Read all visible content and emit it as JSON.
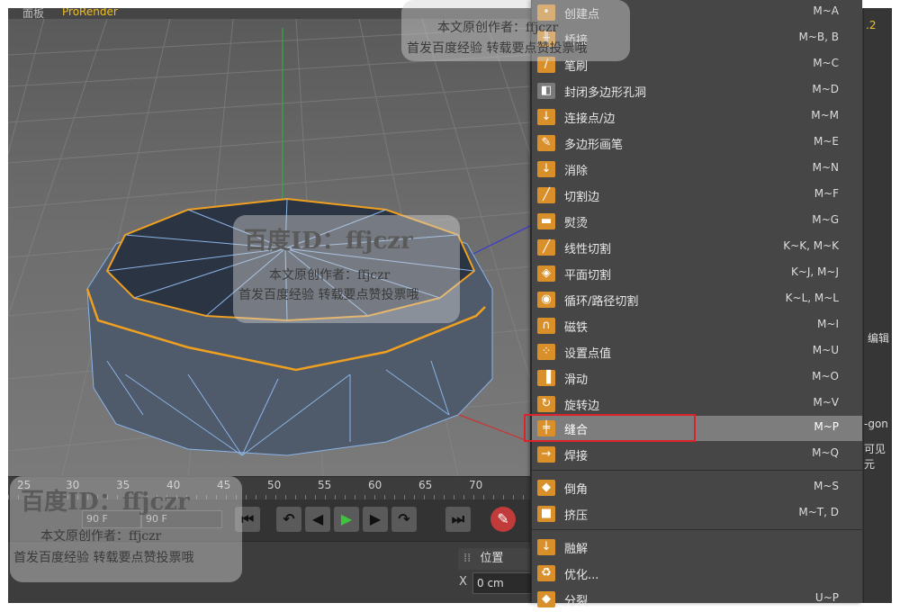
{
  "app": {
    "top_menu": {
      "panel_label": "面板",
      "prorender_label": "ProRender"
    }
  },
  "timeline": {
    "ticks": [
      "25",
      "30",
      "35",
      "40",
      "45",
      "50",
      "55",
      "60",
      "65",
      "70"
    ]
  },
  "transport": {
    "frame_start": "90 F",
    "frame_end": "90 F"
  },
  "coords_panel": {
    "tab_label": "位置",
    "x_label": "X",
    "x_value": "0 cm"
  },
  "right_panel": {
    "edit_label": "编辑",
    "ngon_label": "-gon",
    "visible_label": "可见元",
    "num_label": ".2"
  },
  "context_menu": {
    "items": [
      {
        "label": "创建点",
        "shortcut": "M~A",
        "icon": "create-point-icon",
        "color": "#d9902a"
      },
      {
        "label": "桥接",
        "shortcut": "M~B, B",
        "icon": "bridge-icon",
        "color": "#d9902a"
      },
      {
        "label": "笔刷",
        "shortcut": "M~C",
        "icon": "brush-icon",
        "color": "#d9902a"
      },
      {
        "label": "封闭多边形孔洞",
        "shortcut": "M~D",
        "icon": "close-hole-icon",
        "color": "#7a7a7a"
      },
      {
        "label": "连接点/边",
        "shortcut": "M~M",
        "icon": "connect-icon",
        "color": "#d9902a"
      },
      {
        "label": "多边形画笔",
        "shortcut": "M~E",
        "icon": "polygon-pen-icon",
        "color": "#d9902a"
      },
      {
        "label": "消除",
        "shortcut": "M~N",
        "icon": "dissolve-icon",
        "color": "#d9902a"
      },
      {
        "label": "切割边",
        "shortcut": "M~F",
        "icon": "edge-cut-icon",
        "color": "#d9902a"
      },
      {
        "label": "熨烫",
        "shortcut": "M~G",
        "icon": "iron-icon",
        "color": "#d9902a"
      },
      {
        "label": "线性切割",
        "shortcut": "K~K, M~K",
        "icon": "line-cut-icon",
        "color": "#d9902a"
      },
      {
        "label": "平面切割",
        "shortcut": "K~J, M~J",
        "icon": "plane-cut-icon",
        "color": "#d9902a"
      },
      {
        "label": "循环/路径切割",
        "shortcut": "K~L, M~L",
        "icon": "loop-cut-icon",
        "color": "#d9902a"
      },
      {
        "label": "磁铁",
        "shortcut": "M~I",
        "icon": "magnet-icon",
        "color": "#d9902a"
      },
      {
        "label": "设置点值",
        "shortcut": "M~U",
        "icon": "set-point-icon",
        "color": "#d9902a"
      },
      {
        "label": "滑动",
        "shortcut": "M~O",
        "icon": "slide-icon",
        "color": "#d9902a"
      },
      {
        "label": "旋转边",
        "shortcut": "M~V",
        "icon": "spin-edge-icon",
        "color": "#d9902a"
      },
      {
        "label": "缝合",
        "shortcut": "M~P",
        "icon": "stitch-icon",
        "color": "#d9902a",
        "highlighted": true
      },
      {
        "label": "焊接",
        "shortcut": "M~Q",
        "icon": "weld-icon",
        "color": "#d9902a"
      },
      {
        "label": "倒角",
        "shortcut": "M~S",
        "icon": "bevel-icon",
        "color": "#d9902a"
      },
      {
        "label": "挤压",
        "shortcut": "M~T, D",
        "icon": "extrude-icon",
        "color": "#d9902a"
      },
      {
        "label": "融解",
        "shortcut": "",
        "icon": "melt-icon",
        "color": "#d9902a"
      },
      {
        "label": "优化...",
        "shortcut": "",
        "icon": "optimize-icon",
        "color": "#d9902a"
      },
      {
        "label": "分裂",
        "shortcut": "U~P",
        "icon": "split-icon",
        "color": "#d9902a"
      }
    ]
  },
  "watermark": {
    "id_label": "百度ID：ffjczr",
    "author_line": "本文原创作者：ffjczr",
    "notice_line": "首发百度经验 转载要点赞投票哦"
  },
  "colors": {
    "highlight_box": "#d8242a",
    "menu_bg": "#464646",
    "selection_orange": "#f0a020"
  }
}
